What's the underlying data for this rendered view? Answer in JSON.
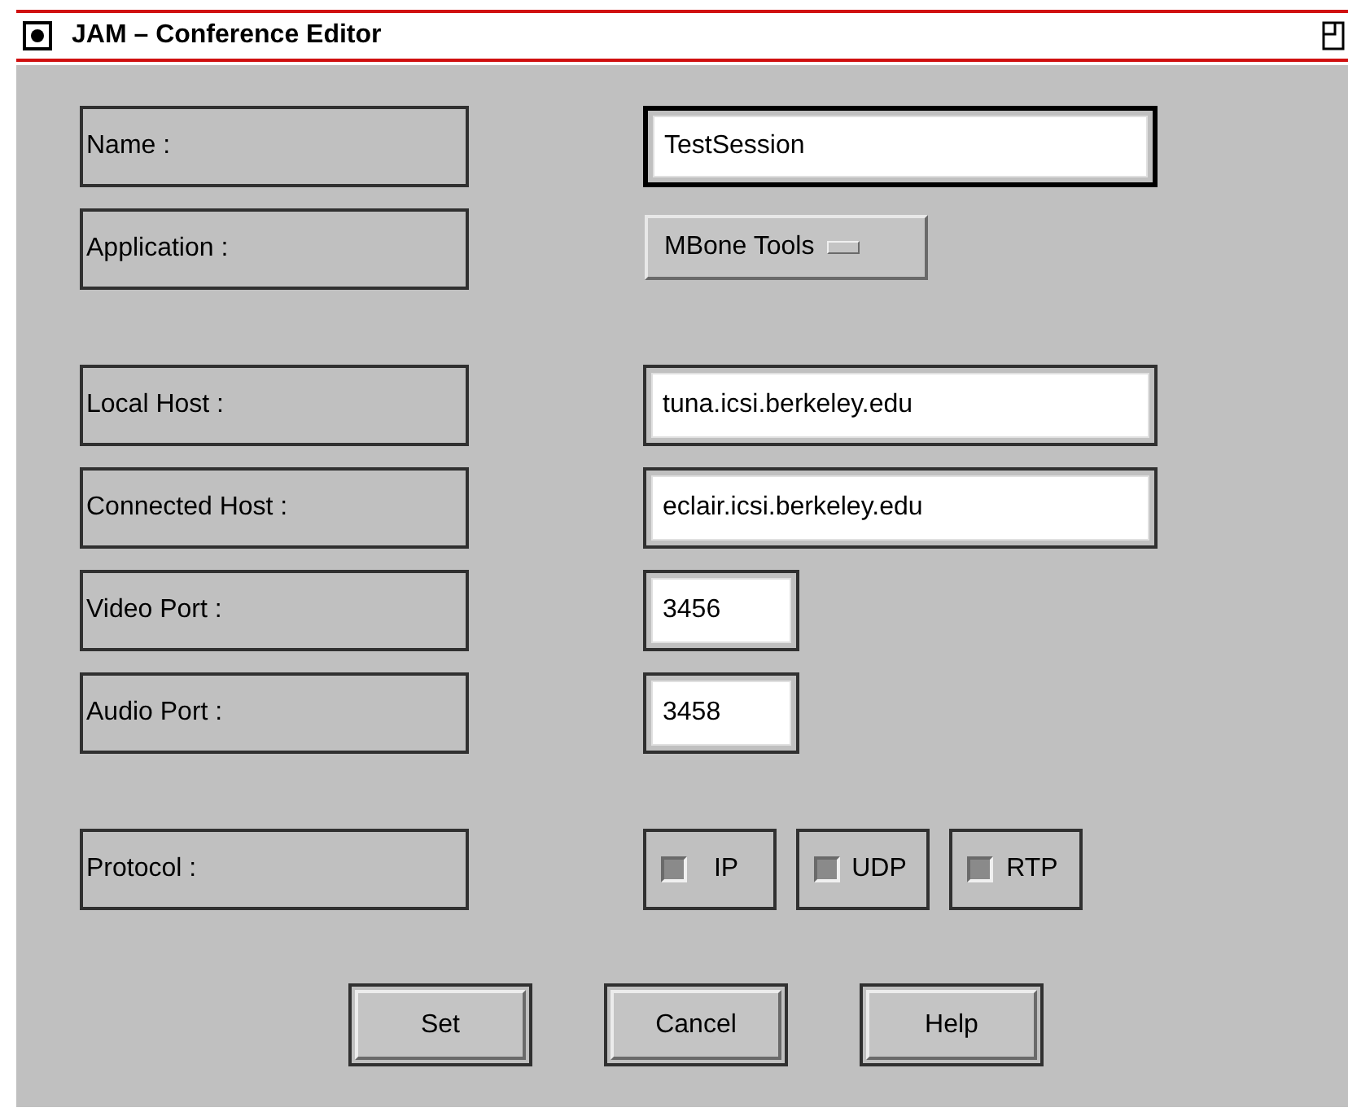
{
  "window": {
    "title": "JAM – Conference Editor"
  },
  "sections": [
    {
      "rows": [
        {
          "label": "Name :",
          "kind": "text",
          "value": "TestSession",
          "focused": true
        },
        {
          "label": "Application :",
          "kind": "option",
          "value": "MBone Tools"
        }
      ]
    },
    {
      "rows": [
        {
          "label": "Local Host :",
          "kind": "text",
          "value": "tuna.icsi.berkeley.edu",
          "focused": false
        },
        {
          "label": "Connected Host :",
          "kind": "text",
          "value": "eclair.icsi.berkeley.edu",
          "focused": false
        },
        {
          "label": "Video Port :",
          "kind": "short_text",
          "value": "3456",
          "focused": false
        },
        {
          "label": "Audio Port :",
          "kind": "short_text",
          "value": "3458",
          "focused": false
        }
      ]
    },
    {
      "rows": [
        {
          "label": "Protocol :",
          "kind": "toggles",
          "options": [
            {
              "label": "IP",
              "checked": true
            },
            {
              "label": "UDP",
              "checked": true
            },
            {
              "label": "RTP",
              "checked": true
            }
          ]
        }
      ]
    }
  ],
  "buttons": [
    "Set",
    "Cancel",
    "Help"
  ]
}
